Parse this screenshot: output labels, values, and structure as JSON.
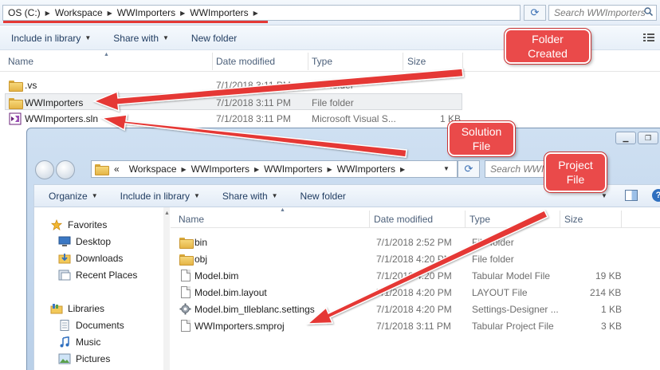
{
  "colors": {
    "accent_red": "#e53935",
    "selection": "#eef0f2",
    "header_text": "#4c607a"
  },
  "back_window": {
    "breadcrumb": [
      "OS (C:)",
      "Workspace",
      "WWImporters",
      "WWImporters"
    ],
    "search": {
      "placeholder": "Search WWImporters"
    },
    "toolbar": {
      "include_label": "Include in library",
      "share_label": "Share with",
      "new_folder_label": "New folder"
    },
    "columns": {
      "name": "Name",
      "date": "Date modified",
      "type": "Type",
      "size": "Size"
    },
    "rows": [
      {
        "name": ".vs",
        "date": "7/1/2018 3:11 PM",
        "type": "File folder",
        "size": ""
      },
      {
        "name": "WWImporters",
        "date": "7/1/2018 3:11 PM",
        "type": "File folder",
        "size": ""
      },
      {
        "name": "WWImporters.sln",
        "date": "7/1/2018 3:11 PM",
        "type": "Microsoft Visual S...",
        "size": "1 KB"
      }
    ]
  },
  "front_window": {
    "breadcrumb": [
      "«",
      "Workspace",
      "WWImporters",
      "WWImporters",
      "WWImporters"
    ],
    "search": {
      "placeholder": "Search WWI"
    },
    "toolbar": {
      "organize_label": "Organize",
      "include_label": "Include in library",
      "share_label": "Share with",
      "new_folder_label": "New folder"
    },
    "nav": {
      "favorites": "Favorites",
      "desktop": "Desktop",
      "downloads": "Downloads",
      "recent": "Recent Places",
      "libraries": "Libraries",
      "documents": "Documents",
      "music": "Music",
      "pictures": "Pictures"
    },
    "columns": {
      "name": "Name",
      "date": "Date modified",
      "type": "Type",
      "size": "Size"
    },
    "rows": [
      {
        "name": "bin",
        "date": "7/1/2018 2:52 PM",
        "type": "File folder",
        "size": ""
      },
      {
        "name": "obj",
        "date": "7/1/2018 4:20 PM",
        "type": "File folder",
        "size": ""
      },
      {
        "name": "Model.bim",
        "date": "7/1/2018 4:20 PM",
        "type": "Tabular Model File",
        "size": "19 KB"
      },
      {
        "name": "Model.bim.layout",
        "date": "7/1/2018 4:20 PM",
        "type": "LAYOUT File",
        "size": "214 KB"
      },
      {
        "name": "Model.bim_tlleblanc.settings",
        "date": "7/1/2018 4:20 PM",
        "type": "Settings-Designer ...",
        "size": "1 KB"
      },
      {
        "name": "WWImporters.smproj",
        "date": "7/1/2018 3:11 PM",
        "type": "Tabular Project File",
        "size": "3 KB"
      }
    ]
  },
  "annotations": {
    "folder_created": {
      "line1": "Folder",
      "line2": "Created"
    },
    "solution_file": {
      "line1": "Solution",
      "line2": "File"
    },
    "project_file": {
      "line1": "Project",
      "line2": "File"
    }
  }
}
